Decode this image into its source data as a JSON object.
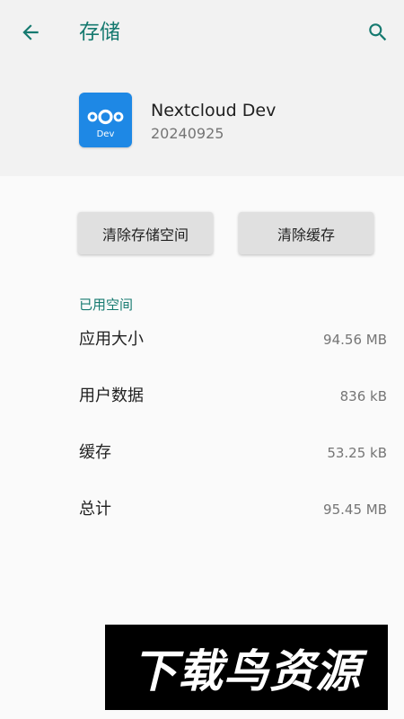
{
  "appbar": {
    "title": "存储",
    "back_icon": "arrow-left-icon",
    "search_icon": "search-icon"
  },
  "app": {
    "name": "Nextcloud Dev",
    "version": "20240925",
    "icon_label": "Dev",
    "icon_color": "#1e88e5"
  },
  "actions": {
    "clear_storage": "清除存储空间",
    "clear_cache": "清除缓存"
  },
  "usage": {
    "section_title": "已用空间",
    "rows": [
      {
        "label": "应用大小",
        "value": "94.56 MB"
      },
      {
        "label": "用户数据",
        "value": "836 kB"
      },
      {
        "label": "缓存",
        "value": "53.25 kB"
      },
      {
        "label": "总计",
        "value": "95.45 MB"
      }
    ]
  },
  "watermark": {
    "text": "下载鸟资源"
  },
  "colors": {
    "accent": "#167a70",
    "header_bg": "#f2f2f2",
    "page_bg": "#fafafa"
  }
}
